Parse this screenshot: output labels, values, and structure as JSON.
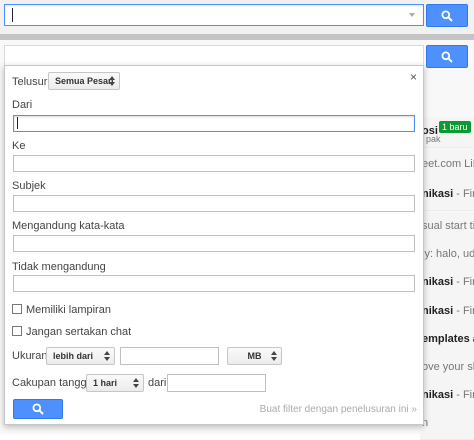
{
  "icons": {
    "search": "search-icon",
    "close": "close-icon",
    "dropdown": "chevron-down-icon"
  },
  "colors": {
    "accent": "#4d90fe",
    "badge_green": "#0a9a2f"
  },
  "background_mail": [
    {
      "strong": "osi",
      "snippet": "",
      "badge": "1 baru",
      "sub": "pak"
    },
    {
      "strong": "",
      "snippet": "eet.com LiN",
      "badge": "",
      "sub": ""
    },
    {
      "strong": "nikasi",
      "snippet": " - Find",
      "badge": "",
      "sub": ""
    },
    {
      "strong": "",
      "snippet": "sual start tim",
      "badge": "",
      "sub": ""
    },
    {
      "strong": "",
      "snippet": "ly: halo, uda",
      "badge": "",
      "sub": ""
    },
    {
      "strong": "nikasi",
      "snippet": " - Find",
      "badge": "",
      "sub": ""
    },
    {
      "strong": "nikasi",
      "snippet": " - Find",
      "badge": "",
      "sub": ""
    },
    {
      "strong": "emplates at",
      "snippet": "",
      "badge": "",
      "sub": ""
    },
    {
      "strong": "",
      "snippet": "ove your skil",
      "badge": "",
      "sub": ""
    },
    {
      "strong": "nikasi",
      "snippet": " - Find",
      "badge": "",
      "sub": ""
    },
    {
      "strong": "",
      "snippet": "n",
      "badge": "",
      "sub": ""
    }
  ],
  "panel": {
    "close": "×",
    "search_in_label": "Telusuri",
    "search_in_value": "Semua Pesan",
    "from_label": "Dari",
    "to_label": "Ke",
    "subject_label": "Subjek",
    "has_words_label": "Mengandung kata-kata",
    "not_has_label": "Tidak mengandung",
    "has_attachment_label": "Memiliki lampiran",
    "exclude_chats_label": "Jangan sertakan chat",
    "size_label": "Ukuran",
    "size_op_value": "lebih dari",
    "size_unit_value": "MB",
    "date_within_label": "Cakupan tanggal",
    "date_within_value": "1 hari",
    "date_from_label": "dari",
    "create_filter_label": "Buat filter dengan penelusuran ini »"
  }
}
